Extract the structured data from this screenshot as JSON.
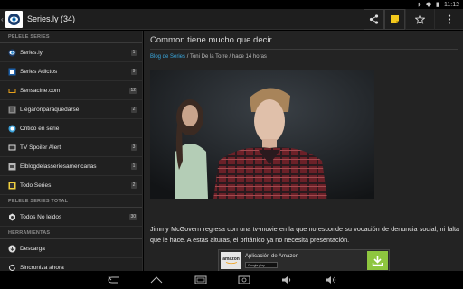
{
  "status": {
    "time": "11:12"
  },
  "app": {
    "title": "Series.ly (34)"
  },
  "sidebar": {
    "sections": [
      {
        "header": "PELELE SERIES"
      },
      {
        "header": "PELELE SERIES TOTAL"
      },
      {
        "header": "HERRAMIENTAS"
      }
    ],
    "items": [
      {
        "label": "Series.ly",
        "count": "1",
        "icon": "series-ly-icon"
      },
      {
        "label": "Series Adictos",
        "count": "9",
        "icon": "series-adictos-icon"
      },
      {
        "label": "Sensacine.com",
        "count": "12",
        "icon": "sensacine-icon"
      },
      {
        "label": "Llegaronparaquedarse",
        "count": "2",
        "icon": "llegaron-icon"
      },
      {
        "label": "Critico en serie",
        "count": "",
        "icon": "critico-icon"
      },
      {
        "label": "TV Spoiler Alert",
        "count": "3",
        "icon": "tv-spoiler-icon"
      },
      {
        "label": "Elblogdelasseriesamericanas",
        "count": "1",
        "icon": "blog-series-icon"
      },
      {
        "label": "Todo Series",
        "count": "2",
        "icon": "todo-series-icon"
      }
    ],
    "total_items": [
      {
        "label": "Todos No leidos",
        "count": "30",
        "icon": "todos-icon"
      }
    ],
    "tool_items": [
      {
        "label": "Descarga",
        "icon": "download-icon"
      },
      {
        "label": "Sincroniza ahora",
        "icon": "sync-icon"
      }
    ]
  },
  "article": {
    "title": "Common tiene mucho que decir",
    "source": "Blog de Series",
    "author": "Toni De la Torre",
    "time": "hace 14 horas",
    "separator": "/",
    "body": "Jimmy McGovern regresa con una tv-movie en la que no esconde su vocación de denuncia social, ni falta que le hace. A estas alturas, el británico ya no necesita presentación."
  },
  "ad": {
    "logo": "amazon",
    "text": "Aplicación de Amazon",
    "badge": "Google play"
  },
  "colors": {
    "link": "#39a9e0",
    "download_green": "#8ec63f",
    "sticky_yellow": "#f2c81c"
  }
}
